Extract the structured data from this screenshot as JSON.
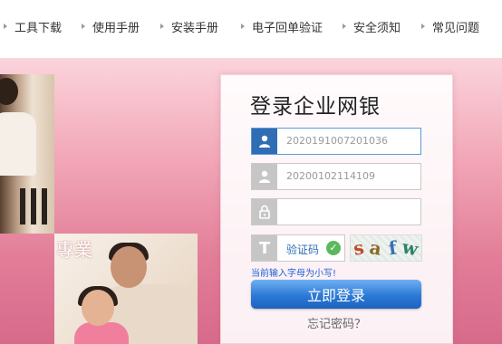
{
  "nav": {
    "items": [
      {
        "label": "工具下载"
      },
      {
        "label": "使用手册"
      },
      {
        "label": "安装手册"
      },
      {
        "label": "电子回单验证"
      },
      {
        "label": "安全须知"
      },
      {
        "label": "常见问题"
      }
    ]
  },
  "banner": {
    "photo_text": "專業"
  },
  "login": {
    "title": "登录企业网银",
    "username_value": "2020191007201036",
    "account_value": "20200102114109",
    "password_value": "",
    "captcha_label": "验证码",
    "captcha_text": [
      "s",
      "a",
      "f",
      "w"
    ],
    "hint": "当前输入字母为小写!",
    "login_button": "立即登录",
    "forgot_link": "忘记密码？"
  },
  "colors": {
    "accent_blue": "#2f6db5",
    "banner_pink": "#e27d98",
    "success_green": "#5cb85c"
  },
  "icons": [
    "user-icon",
    "user-icon",
    "lock-icon",
    "captcha-text-icon",
    "check-icon"
  ]
}
